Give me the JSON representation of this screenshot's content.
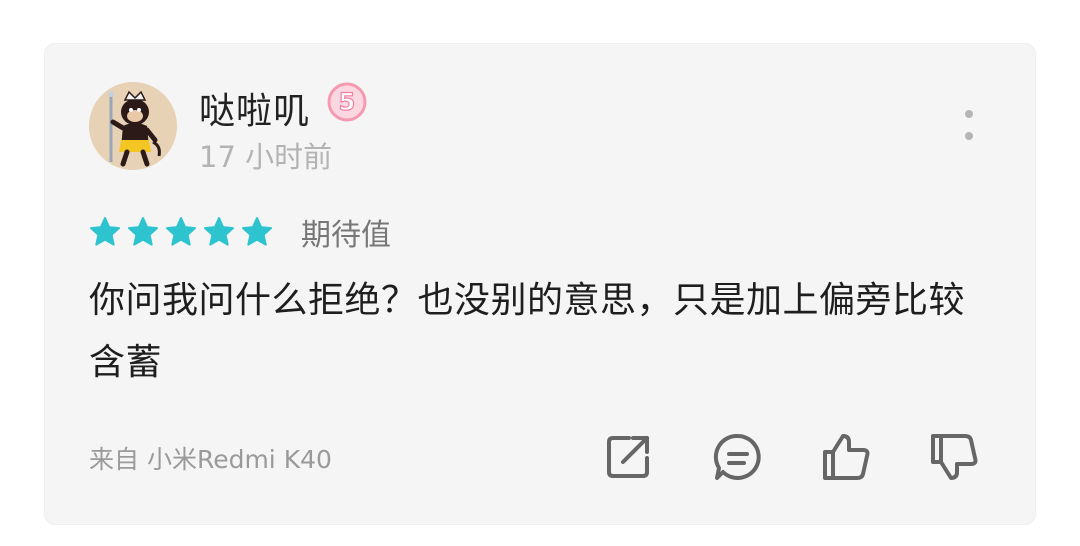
{
  "comment": {
    "user": {
      "name": "哒啦叽",
      "level": "5",
      "avatar_icon": "monkey-avatar-icon"
    },
    "time": "17 小时前",
    "rating": {
      "stars": 5,
      "max": 5,
      "label": "期待值"
    },
    "text": "你问我问什么拒绝？也没别的意思，只是加上偏旁比较含蓄",
    "device": "来自 小米Redmi K40",
    "actions": [
      "share-icon",
      "reply-icon",
      "thumbs-up-icon",
      "thumbs-down-icon"
    ]
  },
  "colors": {
    "card_bg": "#f5f5f5",
    "star": "#2ec4cf",
    "badge": "#f49ab2",
    "icon": "#666666",
    "muted": "#b3b3b3"
  }
}
